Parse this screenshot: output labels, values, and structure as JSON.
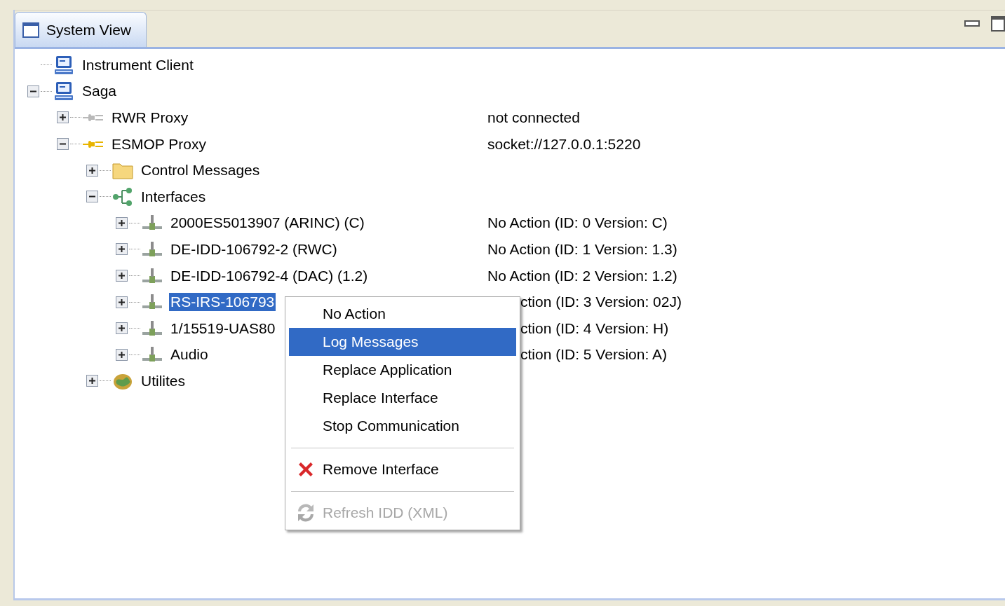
{
  "view": {
    "title": "System View"
  },
  "tree": [
    {
      "label": "Instrument Client",
      "kind": "computer",
      "selected": false
    },
    {
      "label": "Saga",
      "kind": "computer",
      "selected": false,
      "expanded": true,
      "children": [
        {
          "label": "RWR Proxy",
          "kind": "proxy",
          "connected": false,
          "selected": false,
          "expanded": false,
          "status": "not connected"
        },
        {
          "label": "ESMOP Proxy",
          "kind": "proxy",
          "connected": true,
          "selected": false,
          "expanded": true,
          "status": "socket://127.0.0.1:5220",
          "children": [
            {
              "label": "Control Messages",
              "kind": "folder",
              "selected": false,
              "expanded": false
            },
            {
              "label": "Interfaces",
              "kind": "interfaces",
              "selected": false,
              "expanded": true,
              "children": [
                {
                  "label": "2000ES5013907 (ARINC) (C)",
                  "kind": "connector",
                  "selected": false,
                  "expanded": false,
                  "status": "No Action (ID: 0 Version: C)"
                },
                {
                  "label": "DE-IDD-106792-2 (RWC)",
                  "kind": "connector",
                  "selected": false,
                  "expanded": false,
                  "status": "No Action (ID: 1 Version: 1.3)"
                },
                {
                  "label": "DE-IDD-106792-4 (DAC) (1.2)",
                  "kind": "connector",
                  "selected": false,
                  "expanded": false,
                  "status": "No Action (ID: 2 Version: 1.2)"
                },
                {
                  "label": "RS-IRS-106793",
                  "kind": "connector",
                  "selected": true,
                  "expanded": false,
                  "status": "ction (ID: 3 Version: 02J)",
                  "partial": true
                },
                {
                  "label": "1/15519-UAS80",
                  "kind": "connector",
                  "selected": false,
                  "expanded": false,
                  "status": "ction (ID: 4 Version: H)",
                  "partial": true
                },
                {
                  "label": "Audio",
                  "kind": "connector",
                  "selected": false,
                  "expanded": false,
                  "status": "ction (ID: 5 Version: A)",
                  "partial": true
                }
              ]
            },
            {
              "label": "Utilites",
              "kind": "utilities",
              "selected": false,
              "expanded": false
            }
          ]
        }
      ]
    }
  ],
  "context_menu": {
    "groups": [
      [
        {
          "label": "No Action",
          "kind": "plain",
          "selected": false,
          "disabled": false
        },
        {
          "label": "Log Messages",
          "kind": "plain",
          "selected": true,
          "disabled": false
        },
        {
          "label": "Replace Application",
          "kind": "plain",
          "selected": false,
          "disabled": false
        },
        {
          "label": "Replace Interface",
          "kind": "plain",
          "selected": false,
          "disabled": false
        },
        {
          "label": "Stop Communication",
          "kind": "plain",
          "selected": false,
          "disabled": false
        }
      ],
      [
        {
          "label": "Remove Interface",
          "kind": "remove",
          "selected": false,
          "disabled": false
        }
      ],
      [
        {
          "label": "Refresh IDD (XML)",
          "kind": "refresh",
          "selected": false,
          "disabled": true
        }
      ]
    ]
  }
}
